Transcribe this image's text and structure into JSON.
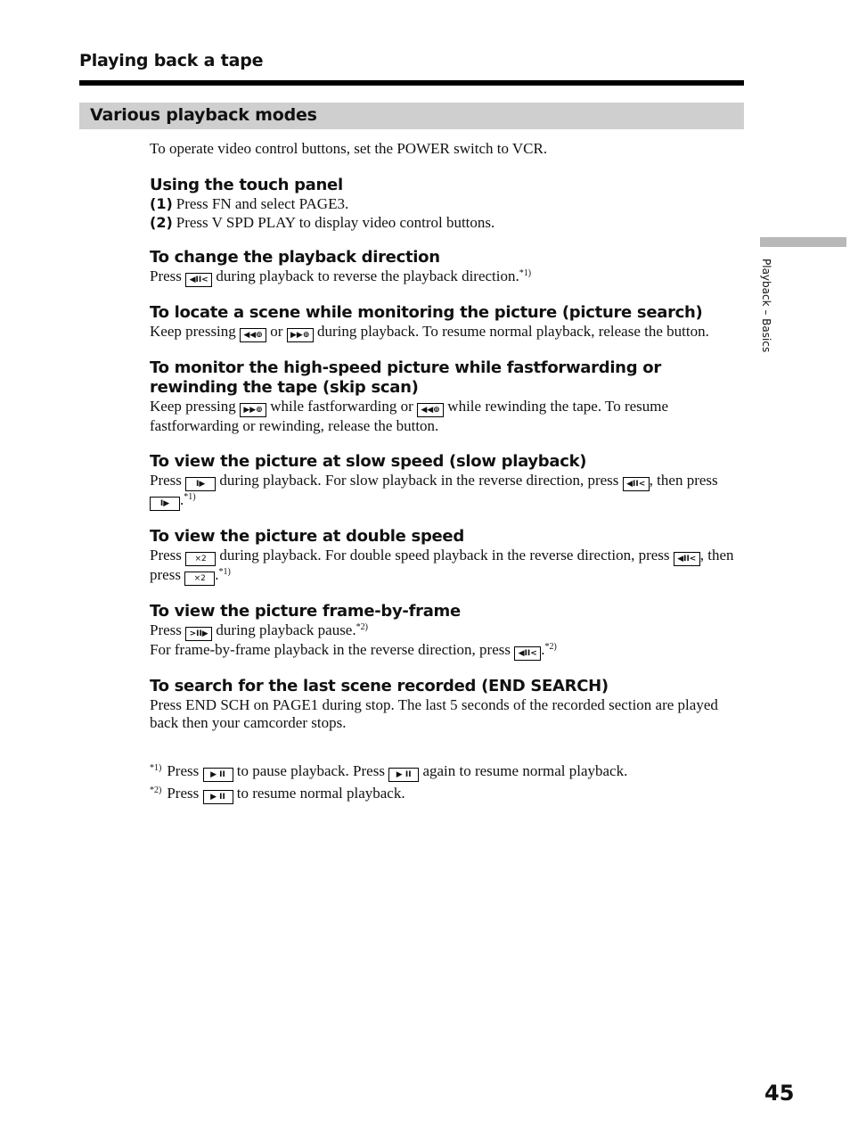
{
  "chapter_title": "Playing back a tape",
  "section_title": "Various playback modes",
  "intro": "To operate video control buttons, set the POWER switch to VCR.",
  "touch_panel": {
    "heading": "Using the touch panel",
    "steps": [
      {
        "num": "(1)",
        "text": "Press FN and select PAGE3."
      },
      {
        "num": "(2)",
        "text": "Press V SPD PLAY to display video control buttons."
      }
    ]
  },
  "buttons": {
    "reverse": "◀II<",
    "rewind": "◀◀⊚",
    "ffwd": "▶▶⊚",
    "slow": "I▶",
    "double": "×2",
    "frame": ">II▶",
    "play_pause": "▶ II"
  },
  "sections": {
    "direction": {
      "heading": "To change the playback direction",
      "t1": "Press",
      "t2": "during playback to reverse the playback direction.",
      "note": "*1)"
    },
    "picture_search": {
      "heading": "To locate a scene while monitoring the picture (picture search)",
      "t1": "Keep pressing",
      "t2": "or",
      "t3": "during playback. To resume normal playback, release the button."
    },
    "skip_scan": {
      "heading": "To monitor the high-speed picture while fastforwarding or rewinding the tape (skip scan)",
      "t1": "Keep pressing",
      "t2": "while fastforwarding or",
      "t3": "while rewinding the tape. To resume fastforwarding or rewinding, release the button."
    },
    "slow": {
      "heading": "To view the picture at slow speed (slow playback)",
      "t1": "Press",
      "t2": "during playback. For slow playback in the reverse direction, press",
      "t3": ", then press",
      "t4": ".",
      "note": "*1)"
    },
    "double": {
      "heading": "To view the picture at double speed",
      "t1": "Press",
      "t2": "during playback. For double speed playback in the reverse direction, press",
      "t3": ", then press",
      "t4": ".",
      "note": "*1)"
    },
    "frame": {
      "heading": "To view the picture frame-by-frame",
      "t1": "Press",
      "t2": "during playback pause.",
      "note1": "*2)",
      "t3": "For frame-by-frame playback in the reverse direction, press",
      "t4": ".",
      "note2": "*2)"
    },
    "end_search": {
      "heading": "To search for the last scene recorded (END SEARCH)",
      "text": "Press END SCH on PAGE1 during stop. The last 5 seconds of the recorded section are played back then your camcorder stops."
    }
  },
  "footnotes": [
    {
      "mark": "*1)",
      "t1": "Press",
      "t2": "to pause playback. Press",
      "t3": "again to resume normal playback."
    },
    {
      "mark": "*2)",
      "t1": "Press",
      "t2": "to resume normal playback."
    }
  ],
  "side_label": "Playback – Basics",
  "page_number": "45"
}
